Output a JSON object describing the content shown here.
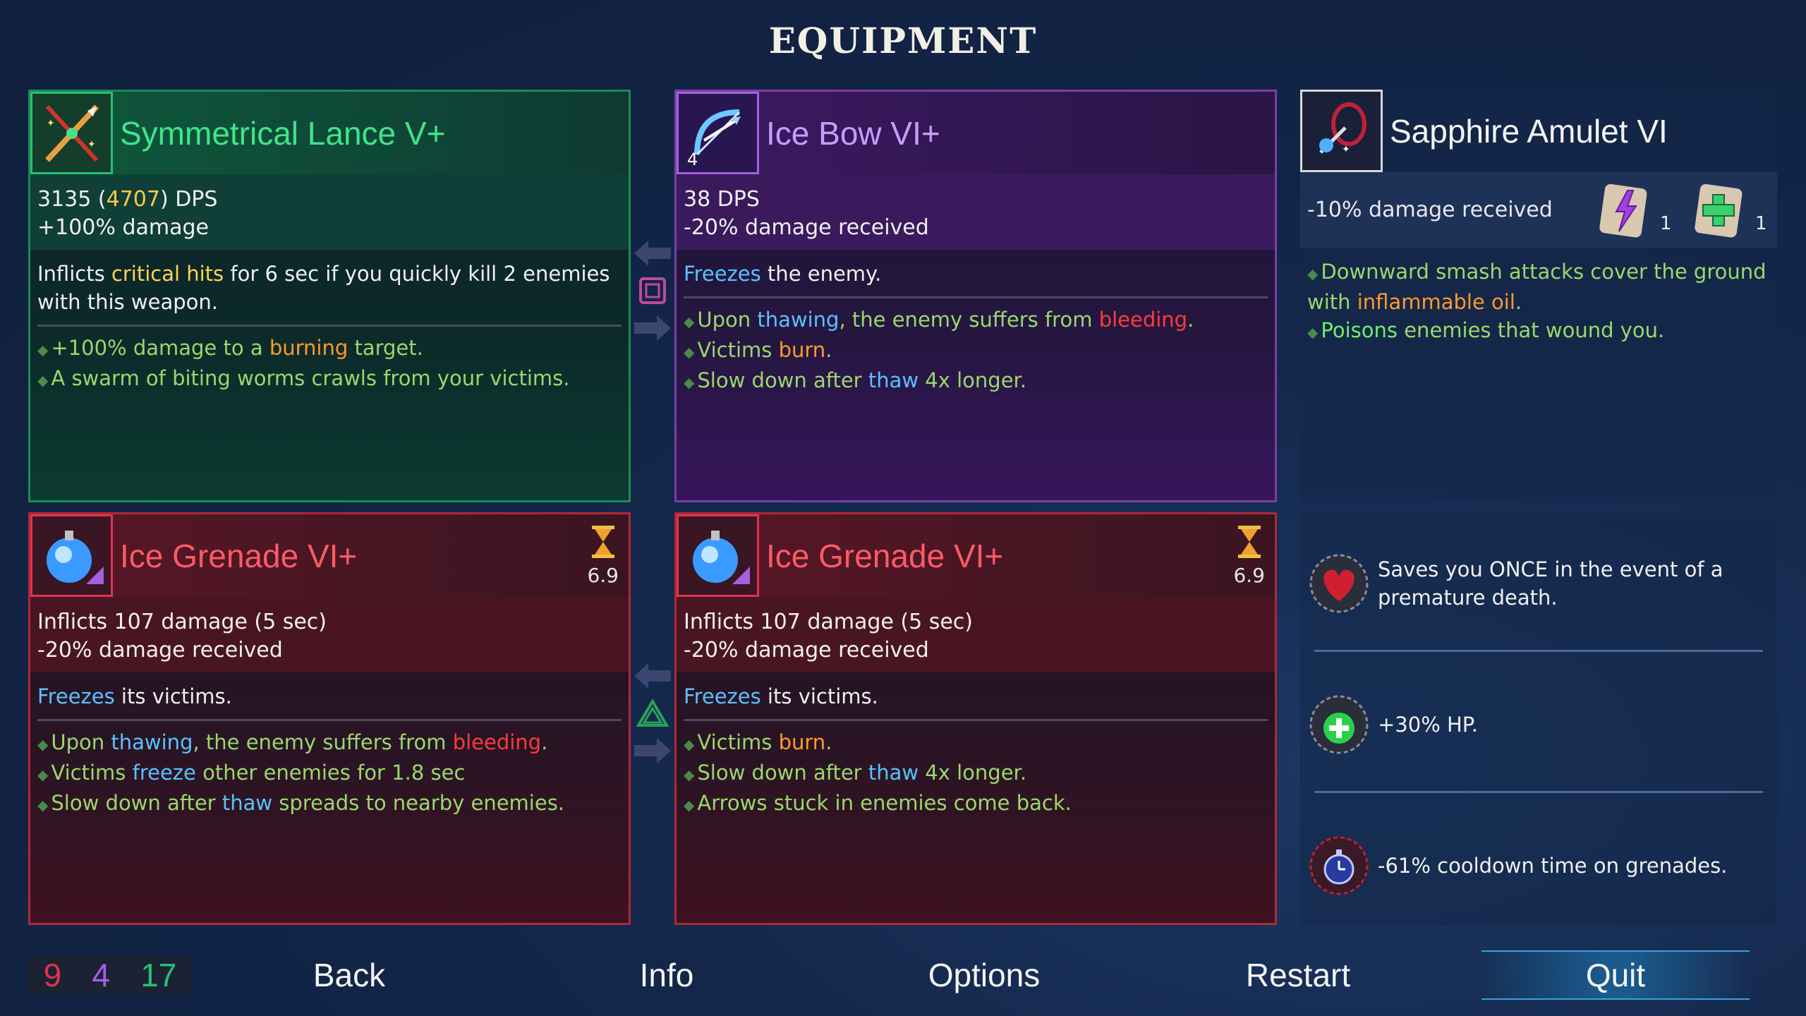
{
  "title": "EQUIPMENT",
  "cards": {
    "lance": {
      "name": "Symmetrical Lance V+",
      "dps_base": "3135",
      "dps_open": " (",
      "dps_alt": "4707",
      "dps_close": ") DPS",
      "stat2": "+100% damage",
      "desc_pre": "Inflicts ",
      "desc_hl": "critical hits",
      "desc_post": " for 6 sec if you quickly kill 2 enemies with this weapon.",
      "b1_pre": "+100% damage to a ",
      "b1_hl": "burning",
      "b1_post": " target.",
      "b2": "A swarm of biting worms crawls from your victims."
    },
    "bow": {
      "name": "Ice Bow VI+",
      "icon_count": "4",
      "stat1": "38 DPS",
      "stat2": "-20% damage received",
      "desc_hl": "Freezes",
      "desc_post": " the enemy.",
      "b1_pre": "Upon ",
      "b1_hl1": "thawing",
      "b1_mid": ", the enemy suffers from ",
      "b1_hl2": "bleeding",
      "b1_post": ".",
      "b2_pre": "Victims ",
      "b2_hl": "burn",
      "b2_post": ".",
      "b3_pre": "Slow down after ",
      "b3_hl": "thaw",
      "b3_post": " 4x longer."
    },
    "grenade1": {
      "name": "Ice Grenade VI+",
      "timer": "6.9",
      "stat1": "Inflicts 107 damage (5 sec)",
      "stat2": "-20% damage received",
      "desc_hl": "Freezes",
      "desc_post": " its victims.",
      "b1_pre": "Upon ",
      "b1_hl1": "thawing",
      "b1_mid": ", the enemy suffers from ",
      "b1_hl2": "bleeding",
      "b1_post": ".",
      "b2_pre": "Victims ",
      "b2_hl": "freeze",
      "b2_post": " other enemies for 1.8 sec",
      "b3_pre": "Slow down after ",
      "b3_hl": "thaw",
      "b3_post": " spreads to nearby enemies."
    },
    "grenade2": {
      "name": "Ice Grenade VI+",
      "timer": "6.9",
      "stat1": "Inflicts 107 damage (5 sec)",
      "stat2": "-20% damage received",
      "desc_hl": "Freezes",
      "desc_post": " its victims.",
      "b1_pre": "Victims ",
      "b1_hl": "burn",
      "b1_post": ".",
      "b2_pre": "Slow down after ",
      "b2_hl": "thaw",
      "b2_post": " 4x longer.",
      "b3": "Arrows stuck in enemies come back."
    }
  },
  "amulet": {
    "name": "Sapphire Amulet VI",
    "stat": "-10% damage received",
    "scroll1_count": "1",
    "scroll2_count": "1",
    "b1_pre": "Downward smash attacks cover the ground with ",
    "b1_hl": "inflammable oil",
    "b1_post": ".",
    "b2_hl": "Poisons",
    "b2_post": " enemies that wound you."
  },
  "passives": [
    {
      "text": "Saves you ONCE in the event of a premature death.",
      "icon": "heart-icon"
    },
    {
      "text": "+30% HP.",
      "icon": "health-potion-icon"
    },
    {
      "text": "-61% cooldown time on grenades.",
      "icon": "stopwatch-icon"
    }
  ],
  "counters": {
    "red": "9",
    "purple": "4",
    "green": "17"
  },
  "nav": {
    "back": "Back",
    "info": "Info",
    "options": "Options",
    "restart": "Restart",
    "quit": "Quit"
  },
  "colors": {
    "brutality": "#e0344c",
    "tactics": "#a460e0",
    "survival": "#27c076",
    "highlight_blue": "#59c2ff"
  }
}
